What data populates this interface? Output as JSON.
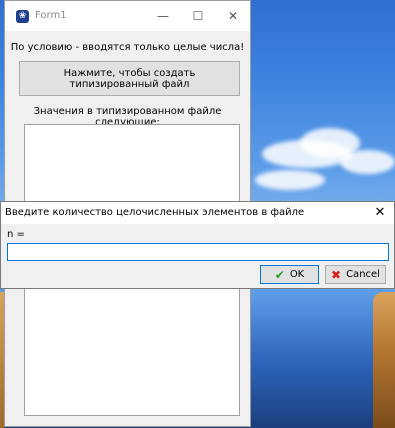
{
  "form1": {
    "title": "Form1",
    "minimize": "—",
    "maximize": "☐",
    "close": "✕",
    "condition_label": "По условию - вводятся только целые числа!",
    "create_button": "Нажмите, чтобы создать типизированный файл",
    "values_label": "Значения в типизированном файле следующие:"
  },
  "dialog": {
    "title": "Введите количество целочисленных элементов в файле",
    "close": "✕",
    "prompt": "n =",
    "input_value": "",
    "ok_label": "OK",
    "ok_icon": "check-icon",
    "cancel_label": "Cancel",
    "cancel_icon": "cross-icon"
  }
}
